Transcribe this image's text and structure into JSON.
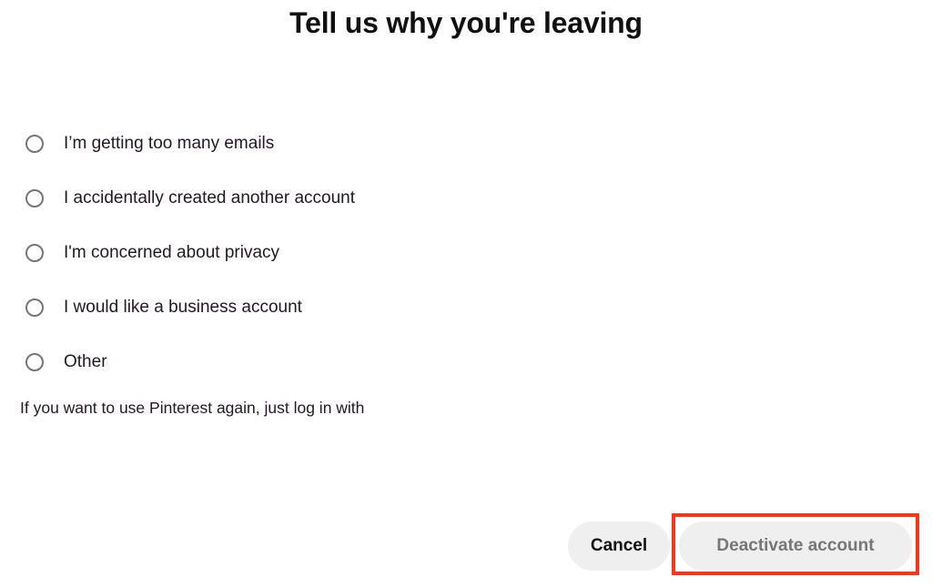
{
  "dialog": {
    "title": "Tell us why you're leaving",
    "helper_text": "If you want to use Pinterest again, just log in with"
  },
  "options": [
    {
      "id": "too-many-emails",
      "label": "I’m getting too many emails",
      "selected": false
    },
    {
      "id": "accidental-account",
      "label": "I accidentally created another account",
      "selected": false
    },
    {
      "id": "privacy-concern",
      "label": "I'm concerned about privacy",
      "selected": false
    },
    {
      "id": "business-account",
      "label": "I would like a business account",
      "selected": false
    },
    {
      "id": "other",
      "label": "Other",
      "selected": false
    }
  ],
  "footer": {
    "cancel_label": "Cancel",
    "deactivate_label": "Deactivate account",
    "deactivate_disabled": true
  },
  "annotation": {
    "target": "deactivate-account-button",
    "color": "#f2371a"
  },
  "colors": {
    "background": "#ffffff",
    "text_primary": "#211922",
    "text_title": "#111111",
    "text_disabled": "#767676",
    "radio_border": "#767676",
    "button_surface": "#efefef",
    "highlight": "#f2371a"
  }
}
